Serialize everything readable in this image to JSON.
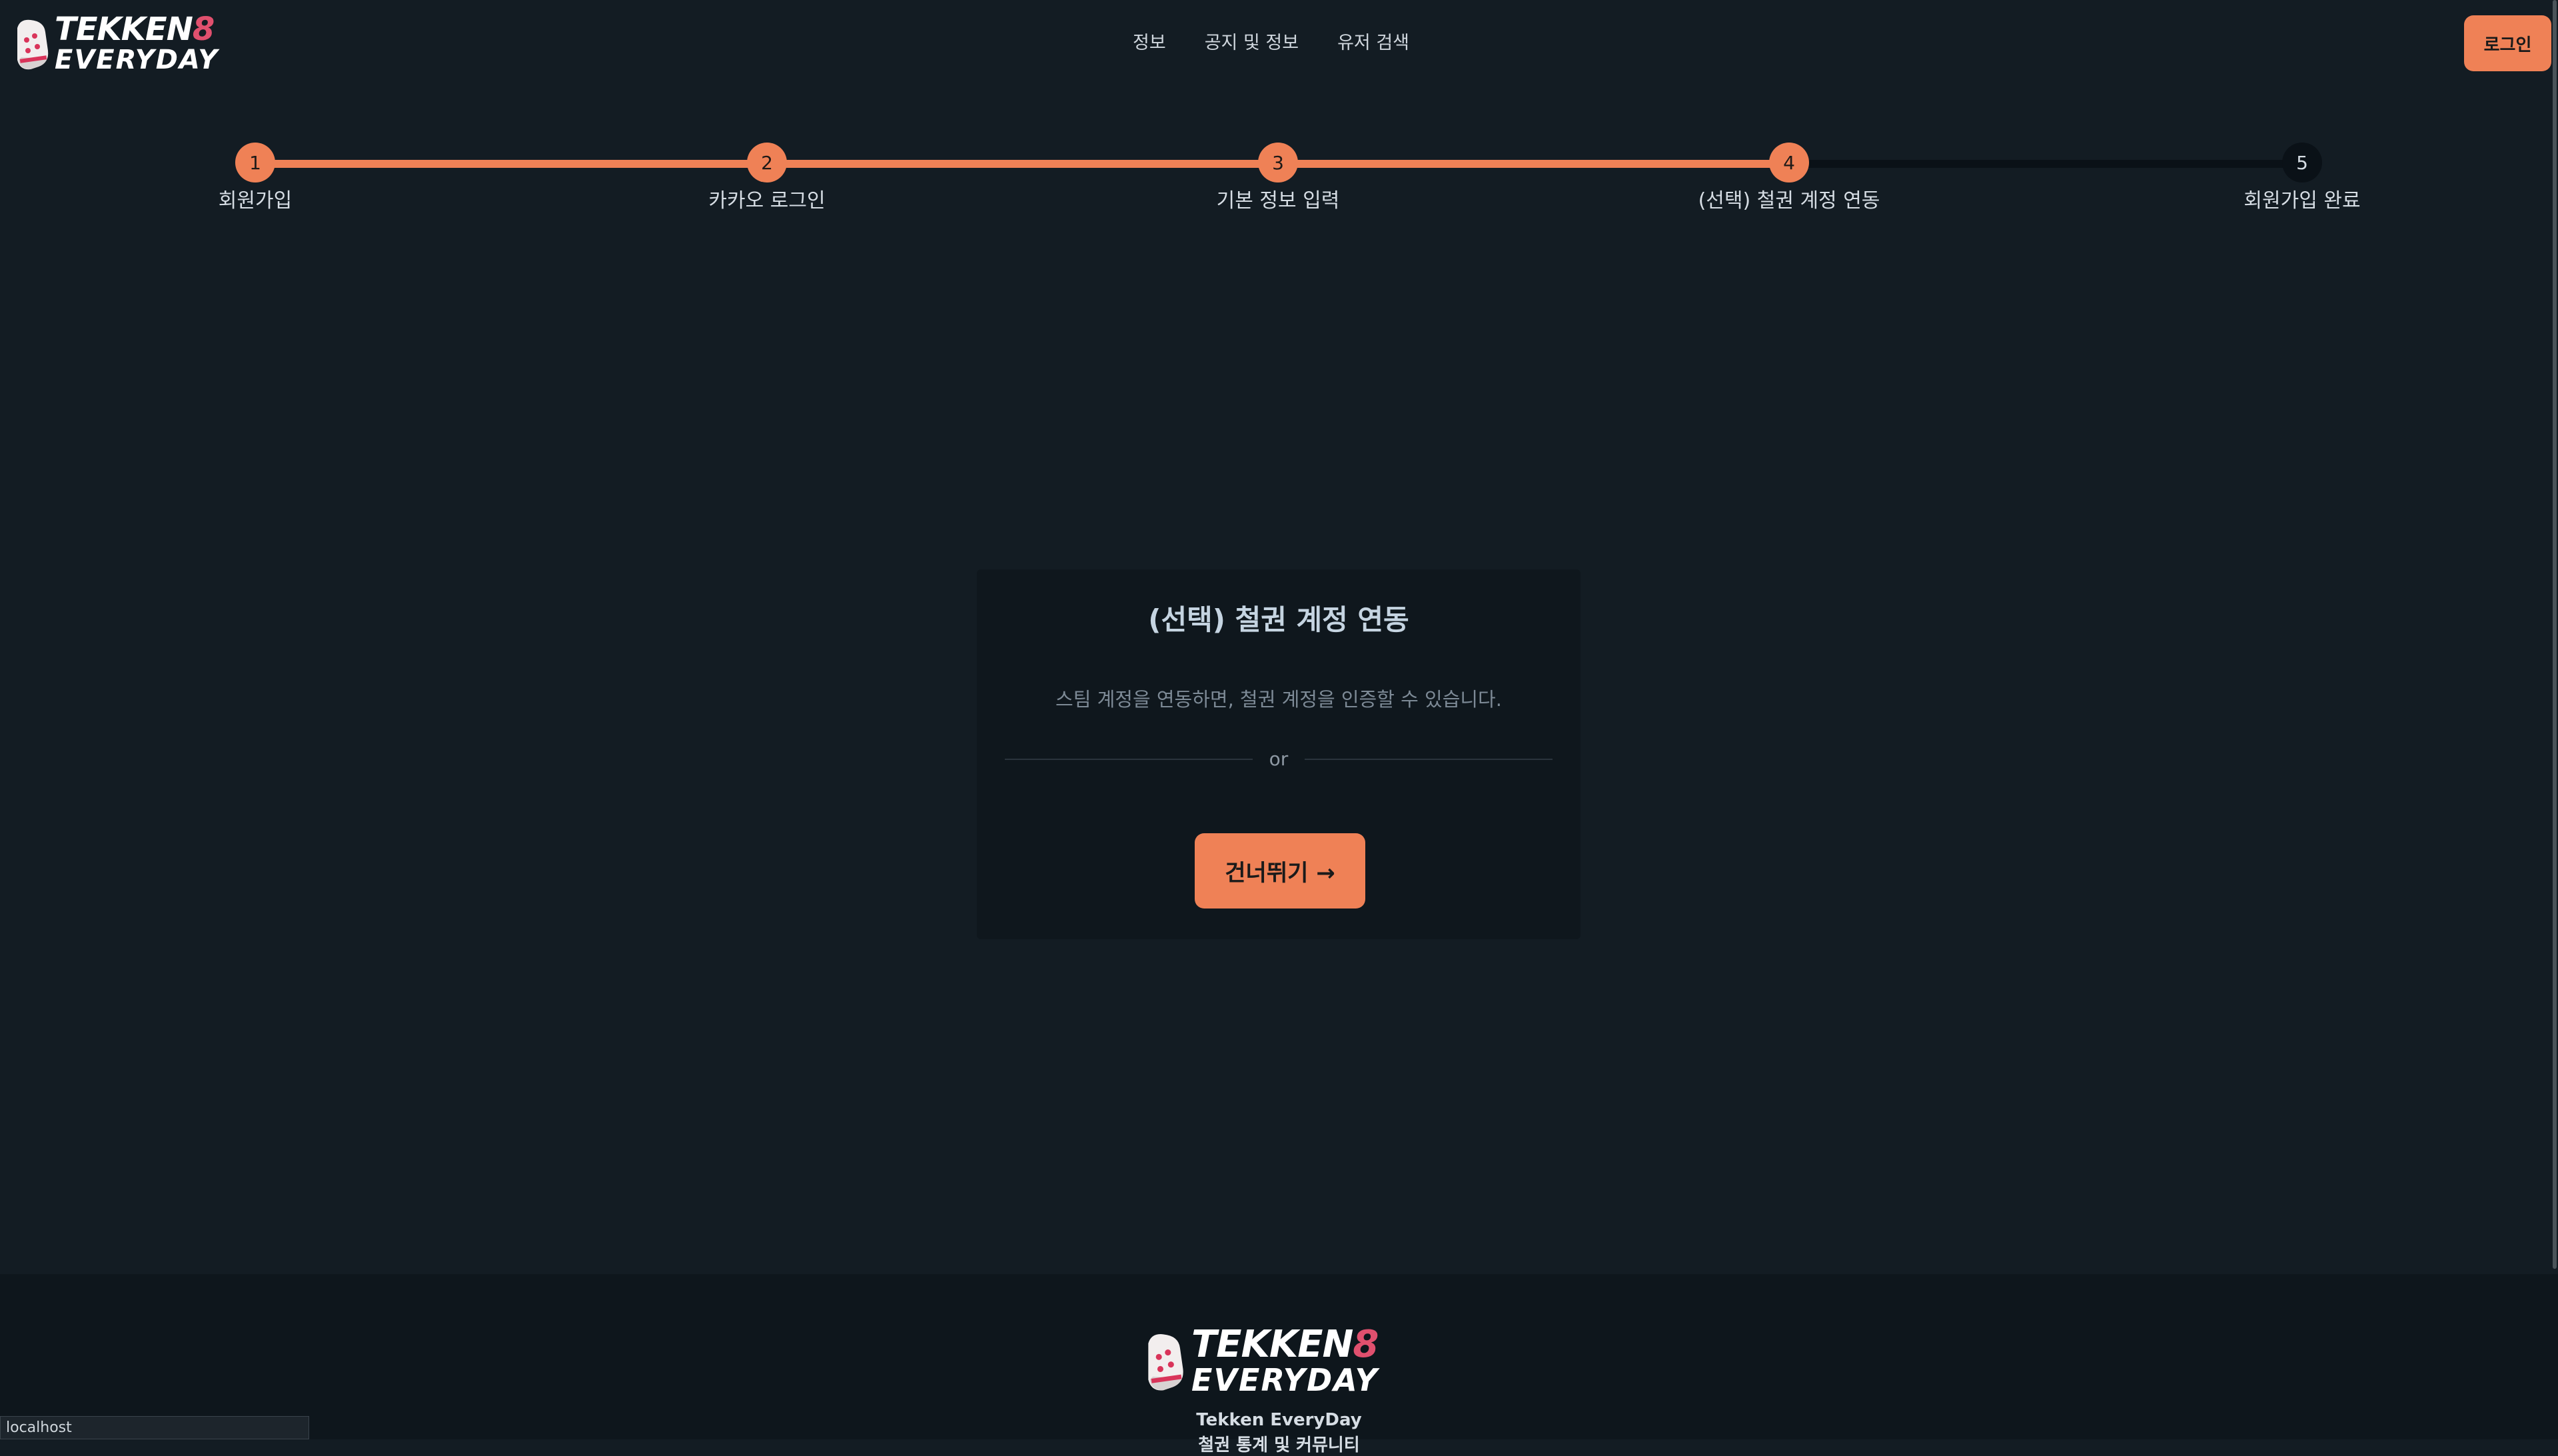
{
  "header": {
    "logo": {
      "brand_line1": "TEKKEN",
      "brand_line1_accent": "8",
      "brand_line2": "EVERYDAY",
      "icon": "tekken-glove-logo"
    },
    "nav": [
      {
        "label": "정보"
      },
      {
        "label": "공지 및 정보"
      },
      {
        "label": "유저 검색"
      }
    ],
    "login_label": "로그인"
  },
  "stepper": {
    "current_step": 4,
    "steps": [
      {
        "number": "1",
        "label": "회원가입",
        "state": "done"
      },
      {
        "number": "2",
        "label": "카카오 로그인",
        "state": "done"
      },
      {
        "number": "3",
        "label": "기본 정보 입력",
        "state": "done"
      },
      {
        "number": "4",
        "label": "(선택) 철권 계정 연동",
        "state": "done"
      },
      {
        "number": "5",
        "label": "회원가입 완료",
        "state": "todo"
      }
    ]
  },
  "card": {
    "title": "(선택) 철권 계정 연동",
    "description": "스팀 계정을 연동하면, 철권 계정을 인증할 수 있습니다.",
    "divider_text": "or",
    "skip_label": "건너뛰기 →"
  },
  "footer": {
    "logo": {
      "brand_line1": "TEKKEN",
      "brand_line1_accent": "8",
      "brand_line2": "EVERYDAY",
      "icon": "tekken-glove-logo"
    },
    "site_name": "Tekken EveryDay",
    "tagline": "철권 통계 및 커뮤니티"
  },
  "status_bar": {
    "url": "localhost"
  },
  "colors": {
    "accent": "#ef8156",
    "background": "#131c23",
    "card_background": "#0f171d",
    "footer_background": "#0e161c",
    "logo_accent": "#e0506e"
  }
}
